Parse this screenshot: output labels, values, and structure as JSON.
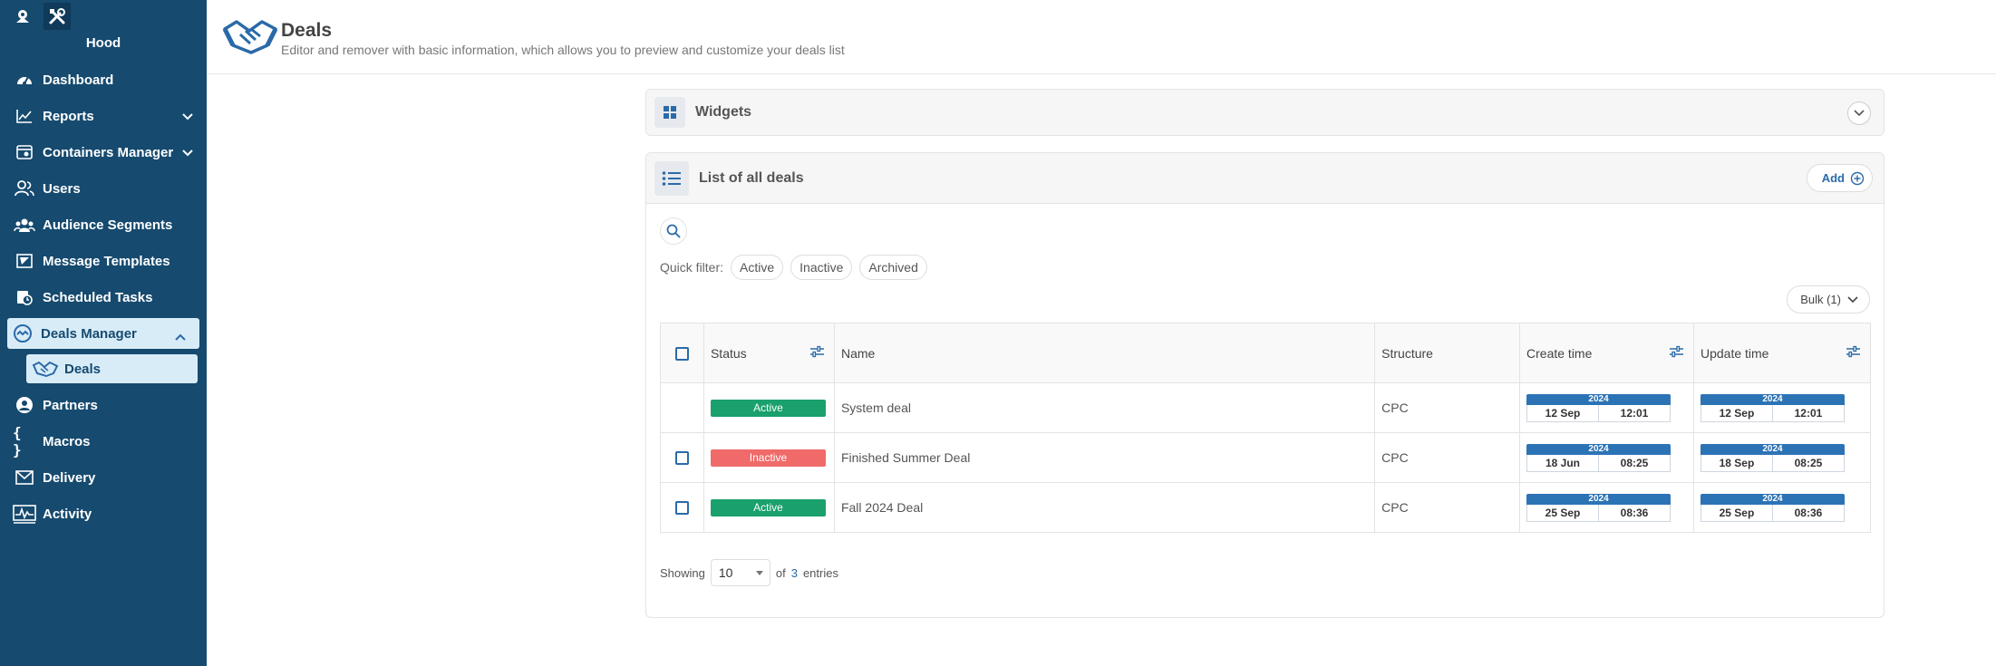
{
  "sidebar": {
    "brand": "Hood",
    "items": [
      {
        "label": "Dashboard"
      },
      {
        "label": "Reports"
      },
      {
        "label": "Containers Manager"
      },
      {
        "label": "Users"
      },
      {
        "label": "Audience Segments"
      },
      {
        "label": "Message Templates"
      },
      {
        "label": "Scheduled Tasks"
      },
      {
        "label": "Deals Manager"
      },
      {
        "label": "Deals"
      },
      {
        "label": "Partners"
      },
      {
        "label": "Macros"
      },
      {
        "label": "Delivery"
      },
      {
        "label": "Activity"
      }
    ]
  },
  "header": {
    "title": "Deals",
    "subtitle": "Editor and remover with basic information, which allows you to preview and customize your deals list"
  },
  "widgets": {
    "title": "Widgets"
  },
  "deals": {
    "title": "List of all deals",
    "add_label": "Add",
    "quick_filter_label": "Quick filter:",
    "filters": [
      "Active",
      "Inactive",
      "Archived"
    ],
    "bulk_label": "Bulk (1)",
    "columns": [
      "Status",
      "Name",
      "Structure",
      "Create time",
      "Update time"
    ],
    "rows": [
      {
        "status": "Active",
        "name": "System deal",
        "structure": "CPC",
        "create": {
          "year": "2024",
          "date": "12 Sep",
          "time": "12:01"
        },
        "update": {
          "year": "2024",
          "date": "12 Sep",
          "time": "12:01"
        }
      },
      {
        "status": "Inactive",
        "name": "Finished Summer Deal",
        "structure": "CPC",
        "create": {
          "year": "2024",
          "date": "18 Jun",
          "time": "08:25"
        },
        "update": {
          "year": "2024",
          "date": "18 Sep",
          "time": "08:25"
        }
      },
      {
        "status": "Active",
        "name": "Fall 2024 Deal",
        "structure": "CPC",
        "create": {
          "year": "2024",
          "date": "25 Sep",
          "time": "08:36"
        },
        "update": {
          "year": "2024",
          "date": "25 Sep",
          "time": "08:36"
        }
      }
    ],
    "footer": {
      "showing": "Showing",
      "page_size": "10",
      "of": "of",
      "total": "3",
      "entries": "entries"
    }
  },
  "colors": {
    "sidebar_bg": "#164a6f",
    "accent": "#2a6aa8",
    "active": "#1aa06c",
    "inactive": "#f06a6a"
  }
}
